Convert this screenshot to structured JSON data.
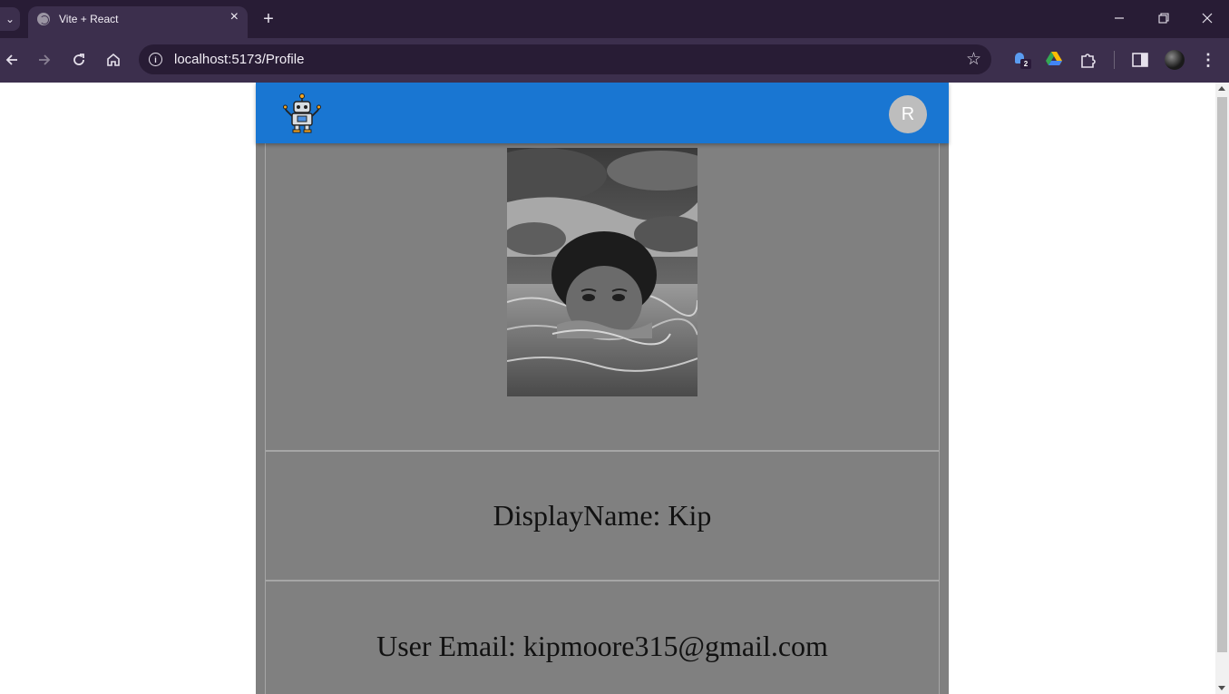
{
  "browser": {
    "tab_title": "Vite + React",
    "url": "localhost:5173/Profile",
    "extension_badge_count": "2",
    "icons": [
      "tab-list-icon",
      "globe-icon",
      "close-icon",
      "plus-icon",
      "minimize-icon",
      "restore-icon",
      "window-close-icon",
      "back-arrow-icon",
      "forward-arrow-icon",
      "reload-icon",
      "home-icon",
      "info-icon",
      "star-icon",
      "drive-icon",
      "puzzle-icon",
      "sidebar-icon",
      "kebab-menu-icon"
    ]
  },
  "app": {
    "colors": {
      "appbar": "#1976d2",
      "page_bg": "#808080",
      "avatar_bg": "#bdbdbd"
    },
    "avatar_initial": "R",
    "profile": {
      "display_name_text": "DisplayName: Kip",
      "email_text": "User Email: kipmoore315@gmail.com"
    }
  }
}
